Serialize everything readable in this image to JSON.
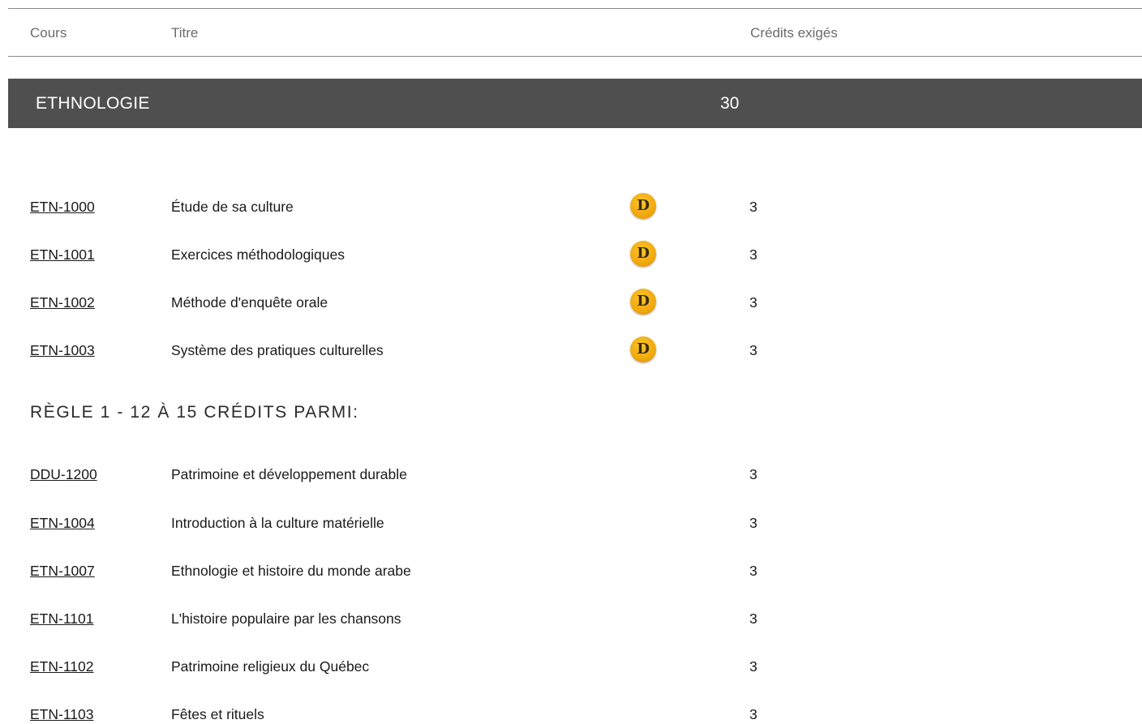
{
  "header": {
    "cours": "Cours",
    "titre": "Titre",
    "credits": "Crédits exigés"
  },
  "section": {
    "name": "ETHNOLOGIE",
    "credits": "30"
  },
  "required_courses": [
    {
      "code": "ETN-1000",
      "title": "Étude de sa culture",
      "badge": "D",
      "credits": "3"
    },
    {
      "code": "ETN-1001",
      "title": "Exercices méthodologiques",
      "badge": "D",
      "credits": "3"
    },
    {
      "code": "ETN-1002",
      "title": "Méthode d'enquête orale",
      "badge": "D",
      "credits": "3"
    },
    {
      "code": "ETN-1003",
      "title": "Système des pratiques culturelles",
      "badge": "D",
      "credits": "3"
    }
  ],
  "rule": {
    "title": "RÈGLE 1 - 12 À 15 CRÉDITS PARMI:"
  },
  "rule_courses": [
    {
      "code": "DDU-1200",
      "title": "Patrimoine et développement durable",
      "credits": "3"
    },
    {
      "code": "ETN-1004",
      "title": "Introduction à la culture matérielle",
      "credits": "3"
    },
    {
      "code": "ETN-1007",
      "title": "Ethnologie et histoire du monde arabe",
      "credits": "3"
    },
    {
      "code": "ETN-1101",
      "title": "L'histoire populaire par les chansons",
      "credits": "3"
    },
    {
      "code": "ETN-1102",
      "title": "Patrimoine religieux du Québec",
      "credits": "3"
    },
    {
      "code": "ETN-1103",
      "title": "Fêtes et rituels",
      "credits": "3"
    }
  ],
  "colors": {
    "section_bar": "#4f4f4f",
    "badge": "#f1a90e"
  }
}
